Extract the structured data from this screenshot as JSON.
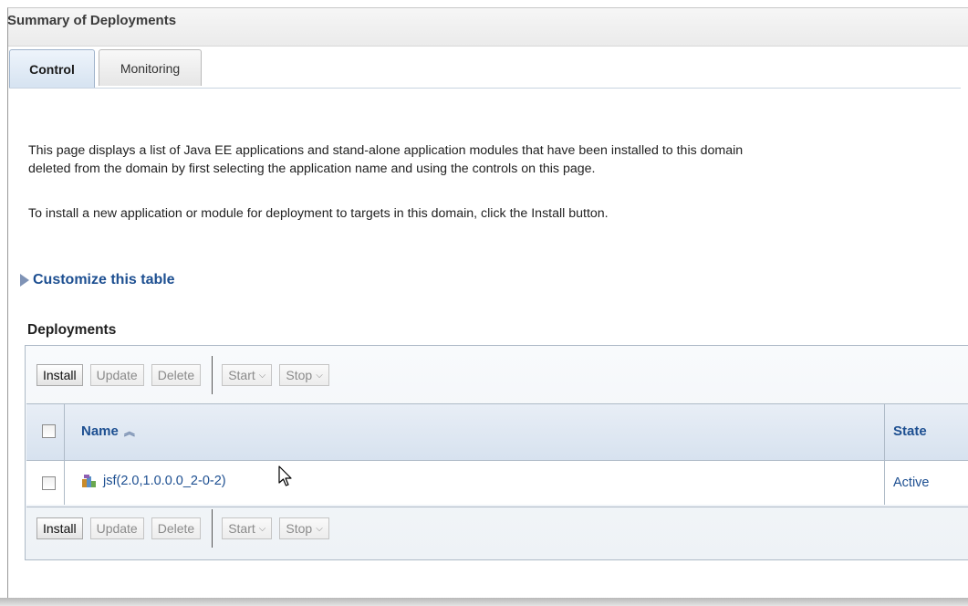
{
  "page": {
    "title": "Summary of Deployments"
  },
  "tabs": [
    {
      "label": "Control",
      "active": true
    },
    {
      "label": "Monitoring",
      "active": false
    }
  ],
  "intro": {
    "line1": "This page displays a list of Java EE applications and stand-alone application modules that have been installed to this domain",
    "line2": "deleted from the domain by first selecting the application name and using the controls on this page.",
    "line3": "To install a new application or module for deployment to targets in this domain, click the Install button."
  },
  "customize": {
    "label": "Customize this table"
  },
  "deployments": {
    "title": "Deployments",
    "toolbar": {
      "install": "Install",
      "update": "Update",
      "delete": "Delete",
      "start": "Start",
      "stop": "Stop"
    },
    "columns": {
      "name": "Name",
      "state": "State"
    },
    "rows": [
      {
        "name": "jsf(2.0,1.0.0.0_2-0-2)",
        "state": "Active"
      }
    ]
  },
  "icons": {
    "expand": "expand-triangle-icon",
    "sort": "sort-ascending-icon",
    "app": "application-icon",
    "cursor": "mouse-pointer-icon"
  },
  "colors": {
    "link": "#1d4f91",
    "header": "#d7e2ef"
  }
}
